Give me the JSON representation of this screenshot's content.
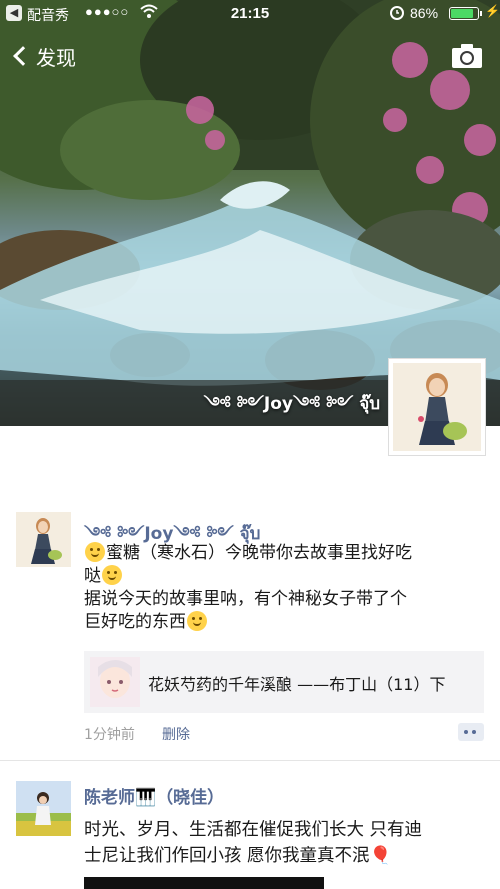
{
  "status_bar": {
    "back_app": "配音秀",
    "signal": "●●●○○",
    "time": "21:15",
    "battery_percent": "86%",
    "battery_level": 0.86,
    "back_icon": "back-to-app-icon",
    "wifi_icon": "wifi-icon",
    "alarm_icon": "alarm-clock-icon",
    "charging_icon": "lightning-bolt-icon"
  },
  "nav": {
    "back_label": "发现",
    "camera_icon": "camera-icon"
  },
  "cover": {
    "name": "༺ ༻Joy༺ ༻ จุ๊บ"
  },
  "posts": [
    {
      "name": "༺ ༻Joy༺ ༻ จุ๊บ",
      "text_line1": "蜜糖（寒水石）今晚带你去故事里找好吃",
      "text_line2": "哒",
      "text_line3": "据说今天的故事里呐，有个神秘女子带了个",
      "text_line4": "巨好吃的东西",
      "share": {
        "title": "花妖芍药的千年溪酿 ——布丁山（11）下"
      },
      "time": "1分钟前",
      "delete_label": "删除"
    },
    {
      "name": "陈老师🎹（晓佳）",
      "text_line1": "时光、岁月、生活都在催促我们长大 只有迪",
      "text_line2": "士尼让我们作回小孩 愿你我童真不泯🎈"
    }
  ],
  "colors": {
    "link_blue": "#576b95",
    "battery_green": "#4cd964",
    "meta_gray": "#a0a0a0",
    "card_bg": "#f3f3f5"
  }
}
